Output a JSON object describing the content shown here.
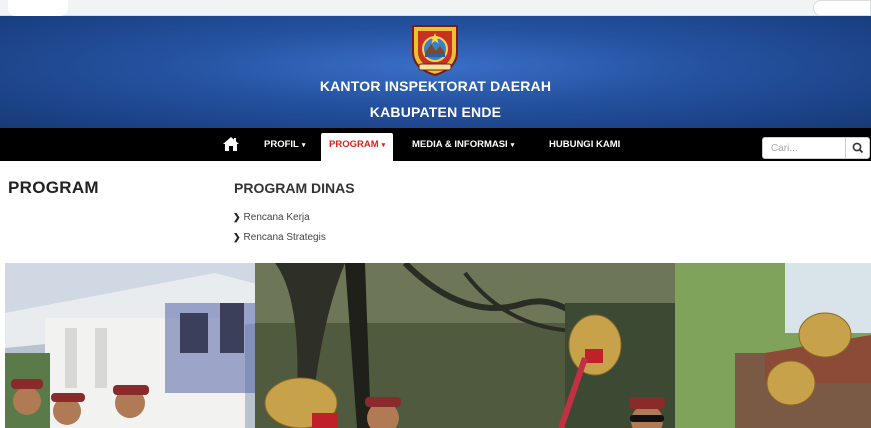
{
  "header": {
    "title_line1": "KANTOR INSPEKTORAT DAERAH",
    "title_line2": "KABUPATEN ENDE",
    "logo_icon": "regional-emblem-icon"
  },
  "nav": {
    "home_icon": "home-icon",
    "items": [
      {
        "label": "PROFIL",
        "dropdown": true
      },
      {
        "label": "PROGRAM",
        "dropdown": true,
        "active": true
      },
      {
        "label": "MEDIA & INFORMASI",
        "dropdown": true
      },
      {
        "label": "HUBUNGI KAMI",
        "dropdown": false
      }
    ],
    "search_placeholder": "Cari...",
    "search_icon": "search-icon"
  },
  "content": {
    "section_title": "PROGRAM",
    "subtitle": "PROGRAM DINAS",
    "links": [
      "Rencana Kerja",
      "Rencana Strategis"
    ]
  },
  "colors": {
    "banner": "#24519f",
    "nav_bg": "#000000",
    "active_text": "#e02020"
  }
}
